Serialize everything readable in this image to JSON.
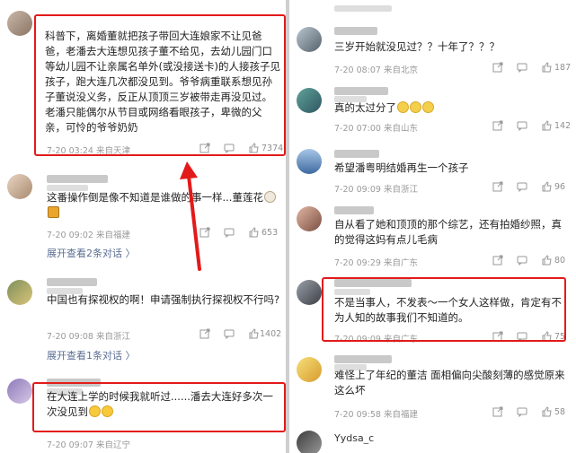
{
  "left": {
    "comments": [
      {
        "text": "科普下，离婚董就把孩子带回大连娘家不让见爸爸，老潘去大连想见孩子董不给见，去幼儿园门口等幼儿园不让亲属名单外(或没接送卡)的人接孩子见孩子，跑大连几次都没见到。爷爷病重联系想见孙子董说没义务，反正从顶顶三岁被带走再没见过。老潘只能偶尔从节目或网络看眼孩子，卑微的父亲，可怜的爷爷奶奶",
        "meta": "7-20 03:24  来自天津",
        "like": "7374"
      },
      {
        "text": "这番操作倒是像不知道是谁做的事一样...董莲花",
        "meta": "7-20 09:02  来自福建",
        "like": "653",
        "more": "展开查看2条对话 〉"
      },
      {
        "text": "中国也有探视权的啊！申请强制执行探视权不行吗?",
        "meta": "7-20 09:08  来自浙江",
        "like": "1402",
        "more": "展开查看1条对话 〉"
      },
      {
        "text": "在大连上学的时候我就听过......潘去大连好多次一次没见到",
        "meta": "7-20 09:07  来自辽宁"
      }
    ]
  },
  "right": {
    "comments": [
      {
        "text": "三岁开始就没见过？？十年了？？？",
        "meta": "7-20 08:07  来自北京",
        "like": "187"
      },
      {
        "text": "真的太过分了",
        "meta": "7-20 07:00  来自山东",
        "like": "142"
      },
      {
        "text": "希望潘粤明结婚再生一个孩子",
        "meta": "7-20 09:09  来自浙江",
        "like": "96"
      },
      {
        "text": "自从看了她和顶顶的那个综艺，还有拍婚纱照，真的觉得这妈有点儿毛病",
        "meta": "7-20 09:29  来自广东",
        "like": "80"
      },
      {
        "text": "不是当事人，不发表～一个女人这样做，肯定有不为人知的故事我们不知道的。",
        "meta": "7-20 09:09  来自广东",
        "like": "75"
      },
      {
        "text": "难怪上了年纪的董洁 面相偏向尖酸刻薄的感觉原来这么坏",
        "meta": "7-20 09:58  来自福建",
        "like": "58"
      },
      {
        "name": "Yydsa_c"
      }
    ]
  },
  "colors": {
    "highlight": "#e31a1a",
    "meta_text": "#9a9a9a",
    "link_text": "#5a6e93",
    "divider": "#cfcfcf"
  },
  "icons": [
    "share-icon",
    "comment-icon",
    "like-icon",
    "smile-emoji",
    "cry-emoji",
    "sheep-emoji",
    "beer-emoji"
  ]
}
